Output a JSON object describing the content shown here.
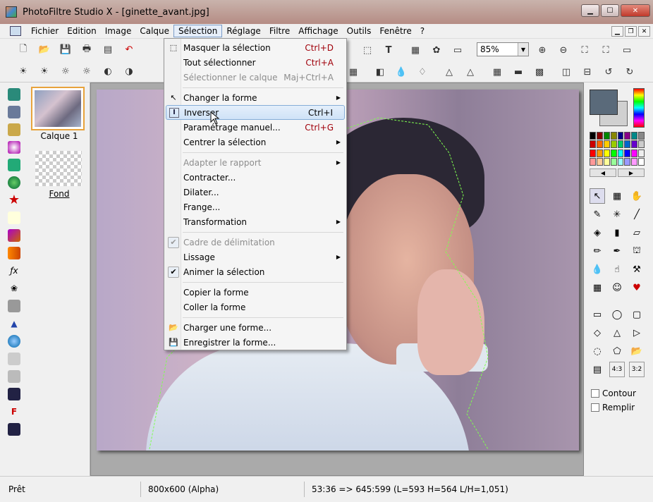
{
  "window": {
    "title": "PhotoFiltre Studio X - [ginette_avant.jpg]"
  },
  "menubar": {
    "items": [
      "Fichier",
      "Edition",
      "Image",
      "Calque",
      "Sélection",
      "Réglage",
      "Filtre",
      "Affichage",
      "Outils",
      "Fenêtre",
      "?"
    ]
  },
  "toolbar": {
    "zoom": "85%"
  },
  "layers": {
    "layer1": "Calque 1",
    "background": "Fond"
  },
  "selection_menu": {
    "masquer": {
      "label": "Masquer la sélection",
      "shortcut": "Ctrl+D"
    },
    "tout": {
      "label": "Tout sélectionner",
      "shortcut": "Ctrl+A"
    },
    "calque": {
      "label": "Sélectionner le calque",
      "shortcut": "Maj+Ctrl+A"
    },
    "forme": {
      "label": "Changer la forme"
    },
    "inverser": {
      "label": "Inverser",
      "shortcut": "Ctrl+I"
    },
    "parametrage": {
      "label": "Paramétrage manuel...",
      "shortcut": "Ctrl+G"
    },
    "centrer": {
      "label": "Centrer la sélection"
    },
    "adapter": {
      "label": "Adapter le rapport"
    },
    "contracter": {
      "label": "Contracter..."
    },
    "dilater": {
      "label": "Dilater..."
    },
    "frange": {
      "label": "Frange..."
    },
    "transformation": {
      "label": "Transformation"
    },
    "cadre": {
      "label": "Cadre de délimitation"
    },
    "lissage": {
      "label": "Lissage"
    },
    "animer": {
      "label": "Animer la sélection"
    },
    "copier": {
      "label": "Copier la forme"
    },
    "coller": {
      "label": "Coller la forme"
    },
    "charger": {
      "label": "Charger une forme..."
    },
    "enregistrer": {
      "label": "Enregistrer la forme..."
    }
  },
  "right_panel": {
    "contour": "Contour",
    "remplir": "Remplir",
    "ratio43": "4:3",
    "ratio32": "3:2"
  },
  "status": {
    "state": "Prêt",
    "size": "800x600 (Alpha)",
    "coords": "53:36 => 645:599 (L=593  H=564  L/H=1,051)"
  }
}
